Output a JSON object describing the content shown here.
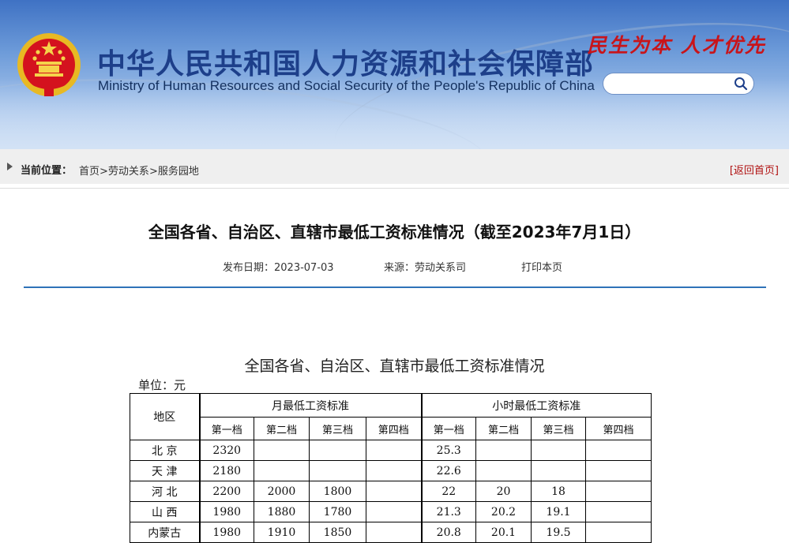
{
  "header": {
    "title_cn": "中华人民共和国人力资源和社会保障部",
    "title_en": "Ministry of Human Resources and Social Security of the People's Republic of China",
    "slogan": "民生为本  人才优先",
    "search_placeholder": ""
  },
  "breadcrumb": {
    "label": "当前位置：",
    "items": [
      "首页",
      ">",
      "劳动关系",
      ">",
      "服务园地"
    ],
    "back_home": "[返回首页]"
  },
  "article": {
    "title": "全国各省、自治区、直辖市最低工资标准情况（截至2023年7月1日）",
    "publish_date": "发布日期：2023-07-03",
    "source": "来源：劳动关系司",
    "print": "打印本页"
  },
  "document": {
    "title": "全国各省、自治区、直辖市最低工资标准情况",
    "unit": "单位：元",
    "table": {
      "region_header": "地区",
      "monthly_header": "月最低工资标准",
      "hourly_header": "小时最低工资标准",
      "tiers": [
        "第一档",
        "第二档",
        "第三档",
        "第四档"
      ],
      "rows": [
        {
          "region": "北 京",
          "monthly": [
            "2320",
            "",
            "",
            ""
          ],
          "hourly": [
            "25.3",
            "",
            "",
            ""
          ]
        },
        {
          "region": "天 津",
          "monthly": [
            "2180",
            "",
            "",
            ""
          ],
          "hourly": [
            "22.6",
            "",
            "",
            ""
          ]
        },
        {
          "region": "河 北",
          "monthly": [
            "2200",
            "2000",
            "1800",
            ""
          ],
          "hourly": [
            "22",
            "20",
            "18",
            ""
          ]
        },
        {
          "region": "山 西",
          "monthly": [
            "1980",
            "1880",
            "1780",
            ""
          ],
          "hourly": [
            "21.3",
            "20.2",
            "19.1",
            ""
          ]
        },
        {
          "region": "内蒙古",
          "monthly": [
            "1980",
            "1910",
            "1850",
            ""
          ],
          "hourly": [
            "20.8",
            "20.1",
            "19.5",
            ""
          ]
        }
      ]
    }
  },
  "colors": {
    "header_blue": "#3f72c4",
    "title_blue": "#1d3f8a",
    "slogan_red": "#c8141a",
    "rule_blue": "#2f73b8",
    "back_home_red": "#b01010"
  }
}
